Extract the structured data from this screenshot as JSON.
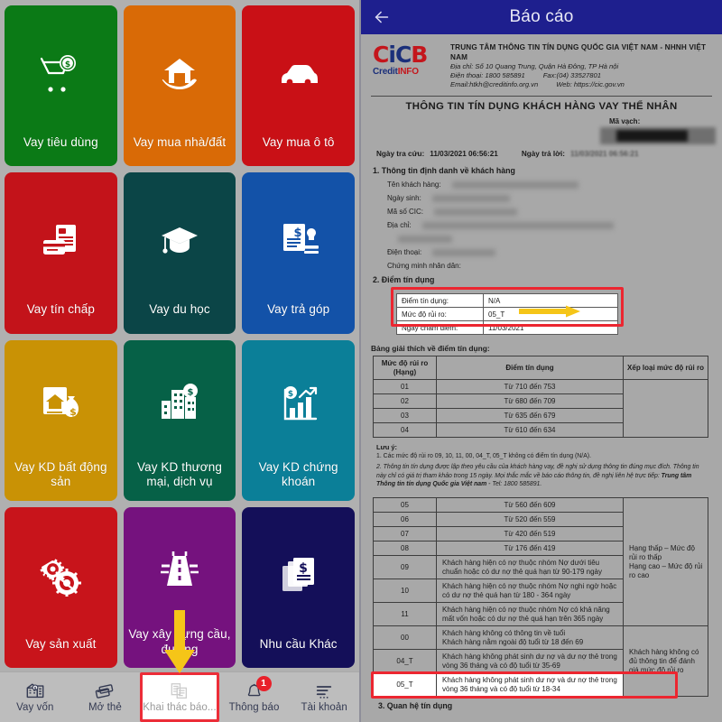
{
  "left": {
    "tiles": [
      {
        "label": "Vay tiêu dùng",
        "color": "#0b7a16",
        "icon": "shopping-cart-money-icon"
      },
      {
        "label": "Vay mua nhà/đất",
        "color": "#d96a06",
        "icon": "house-in-hand-icon"
      },
      {
        "label": "Vay mua ô tô",
        "color": "#c91016",
        "icon": "car-icon"
      },
      {
        "label": "Vay tín chấp",
        "color": "#c3131a",
        "icon": "credit-card-documents-icon"
      },
      {
        "label": "Vay du học",
        "color": "#0b4547",
        "icon": "graduation-cap-icon"
      },
      {
        "label": "Vay trả góp",
        "color": "#1352a8",
        "icon": "document-stamp-icon"
      },
      {
        "label": "Vay KD bất động sản",
        "color": "#c99205",
        "icon": "house-money-bag-icon"
      },
      {
        "label": "Vay KD thương mại, dịch vụ",
        "color": "#066147",
        "icon": "buildings-money-icon"
      },
      {
        "label": "Vay KD chứng khoán",
        "color": "#0b7f98",
        "icon": "bar-chart-money-icon"
      },
      {
        "label": "Vay sản xuất",
        "color": "#c8141b",
        "icon": "gears-icon"
      },
      {
        "label": "Vay xây dựng cầu, đường",
        "color": "#75127e",
        "icon": "highway-icon"
      },
      {
        "label": "Nhu cầu Khác",
        "color": "#140f59",
        "icon": "documents-money-icon"
      }
    ],
    "bottom_nav": [
      {
        "label": "Vay vốn",
        "icon": "bank-money-icon",
        "active": false,
        "badge": ""
      },
      {
        "label": "Mở thẻ",
        "icon": "cards-icon",
        "active": false,
        "badge": ""
      },
      {
        "label": "Khai thác báo...",
        "icon": "report-extract-icon",
        "active": true,
        "badge": ""
      },
      {
        "label": "Thông báo",
        "icon": "bell-icon",
        "active": false,
        "badge": "1"
      },
      {
        "label": "Tài khoản",
        "icon": "menu-lines-icon",
        "active": false,
        "badge": ""
      }
    ],
    "annotation": {
      "arrow": "down-arrow-annotation",
      "arrow_color": "#f5c518",
      "highlight_color": "#ec2d38"
    }
  },
  "right": {
    "app_bar": {
      "title": "Báo cáo",
      "back_icon": "back-arrow-icon",
      "bg": "#1e1f8e"
    },
    "logo": {
      "mark_1": "C",
      "mark_2": "i",
      "mark_3": "C",
      "mark_4": "B",
      "sub_1": "Credit",
      "sub_2": "INFO"
    },
    "org": {
      "name": "TRUNG TÂM THÔNG TIN TÍN DỤNG QUỐC GIA VIỆT NAM - NHNH VIỆT NAM",
      "address": "Địa chỉ: Số 10 Quang Trung, Quận Hà Đông, TP Hà nội",
      "phone": "Điện thoại: 1800 585891",
      "fax": "Fax:(04) 33527801",
      "email": "Email:htkh@creditinfo.org.vn",
      "web": "Web: https://cic.gov.vn"
    },
    "doc_title": "THÔNG TIN TÍN DỤNG KHÁCH HÀNG VAY THỂ NHÂN",
    "barcode_label": "Mã vạch:",
    "dates": {
      "lookup_label": "Ngày tra cứu:",
      "lookup_value": "11/03/2021 06:56:21",
      "reply_label": "Ngày trả lời:",
      "reply_value": "11/03/2021 06:56:21"
    },
    "section1": {
      "title": "1. Thông tin định danh về khách hàng",
      "fields": [
        {
          "label": "Tên khách hàng:",
          "redacted_width": 140
        },
        {
          "label": "Ngày sinh:",
          "redacted_width": 86
        },
        {
          "label": "Mã số CIC:",
          "redacted_width": 92
        },
        {
          "label": "Địa chỉ:",
          "redacted_width": 212
        },
        {
          "label": "",
          "redacted_width": 60
        },
        {
          "label": "Điện thoại:",
          "redacted_width": 70
        },
        {
          "label": "Chứng minh nhân dân:",
          "redacted_width": 0
        }
      ]
    },
    "section2": {
      "title": "2. Điểm tín dụng",
      "score_rows": [
        {
          "key": "Điểm tín dụng:",
          "value": "N/A"
        },
        {
          "key": "Mức độ rủi ro:",
          "value": "05_T"
        },
        {
          "key": "Ngày chấm điểm:",
          "value": "11/03/2021"
        }
      ],
      "table_caption": "Bảng giải thích về điểm tín dụng:",
      "table_headers": [
        "Mức độ rủi ro (Hạng)",
        "Điểm tín dụng",
        "Xếp loại mức độ rủi ro"
      ],
      "table_rows_top": [
        {
          "rank": "01",
          "score": "Từ 710 đến 753",
          "class": ""
        },
        {
          "rank": "02",
          "score": "Từ 680 đến 709",
          "class": ""
        },
        {
          "rank": "03",
          "score": "Từ 635 đến 679",
          "class": ""
        },
        {
          "rank": "04",
          "score": "Từ 610 đến 634",
          "class": ""
        }
      ],
      "notes_title": "Lưu ý:",
      "note_1": "1. Các mức độ rủi ro 09, 10, 11, 00, 04_T, 05_T không có điểm tín dụng (N/A).",
      "note_2_a": "2. Thông tin tín dụng được lập theo yêu cầu của khách hàng vay, đề nghị sử dụng thông tin đúng mục đích. Thông tin này chỉ có giá trị tham khảo trong 15 ngày. Mọi thắc mắc về báo cáo thông tin, đề nghị liên hệ trực tiếp: ",
      "note_2_b": "Trung tâm Thông tin tín dụng Quốc gia Việt nam",
      "note_2_c": " - Tel: 1800 585891.",
      "table_rows_bottom": [
        {
          "rank": "05",
          "score": "Từ 560 đến 609",
          "class": "",
          "hl": false
        },
        {
          "rank": "06",
          "score": "Từ 520 đến 559",
          "class": "",
          "hl": false
        },
        {
          "rank": "07",
          "score": "Từ 420 đến 519",
          "class": "",
          "hl": false
        },
        {
          "rank": "08",
          "score": "Từ 176 đến 419",
          "class": "Hạng thấp – Mức độ rủi ro thấp\nHạng cao – Mức độ rủi ro cao",
          "hl": false
        },
        {
          "rank": "09",
          "score": "Khách hàng hiện có nợ thuộc nhóm Nợ dưới tiêu chuẩn hoặc có dư nợ thẻ quá hạn từ 90-179 ngày",
          "class": "",
          "hl": false
        },
        {
          "rank": "10",
          "score": "Khách hàng hiện có nợ thuộc nhóm Nợ nghi ngờ hoặc có dư nợ thẻ quá hạn từ 180 - 364 ngày",
          "class": "",
          "hl": false
        },
        {
          "rank": "11",
          "score": "Khách hàng hiện có nợ thuộc nhóm Nợ có khả năng mất vốn hoặc có dư nợ thẻ quá hạn trên 365 ngày",
          "class": "",
          "hl": false
        },
        {
          "rank": "00",
          "score": "Khách hàng không có thông tin về tuổi\nKhách hàng nằm ngoài độ tuổi từ 18 đến 69",
          "class": "Khách hàng không có đủ thông tin để đánh giá mức độ rủi ro",
          "hl": false
        },
        {
          "rank": "04_T",
          "score": "Khách hàng không phát sinh dư nợ và dư nợ thẻ trong vòng 36 tháng và có độ tuổi từ 35-69",
          "class": "",
          "hl": false
        },
        {
          "rank": "05_T",
          "score": "Khách hàng không phát sinh dư nợ và dư nợ thẻ trong vòng 36 tháng và có độ tuổi từ 18-34",
          "class": "",
          "hl": true
        }
      ]
    },
    "section3": {
      "title": "3. Quan hệ tín dụng"
    }
  }
}
